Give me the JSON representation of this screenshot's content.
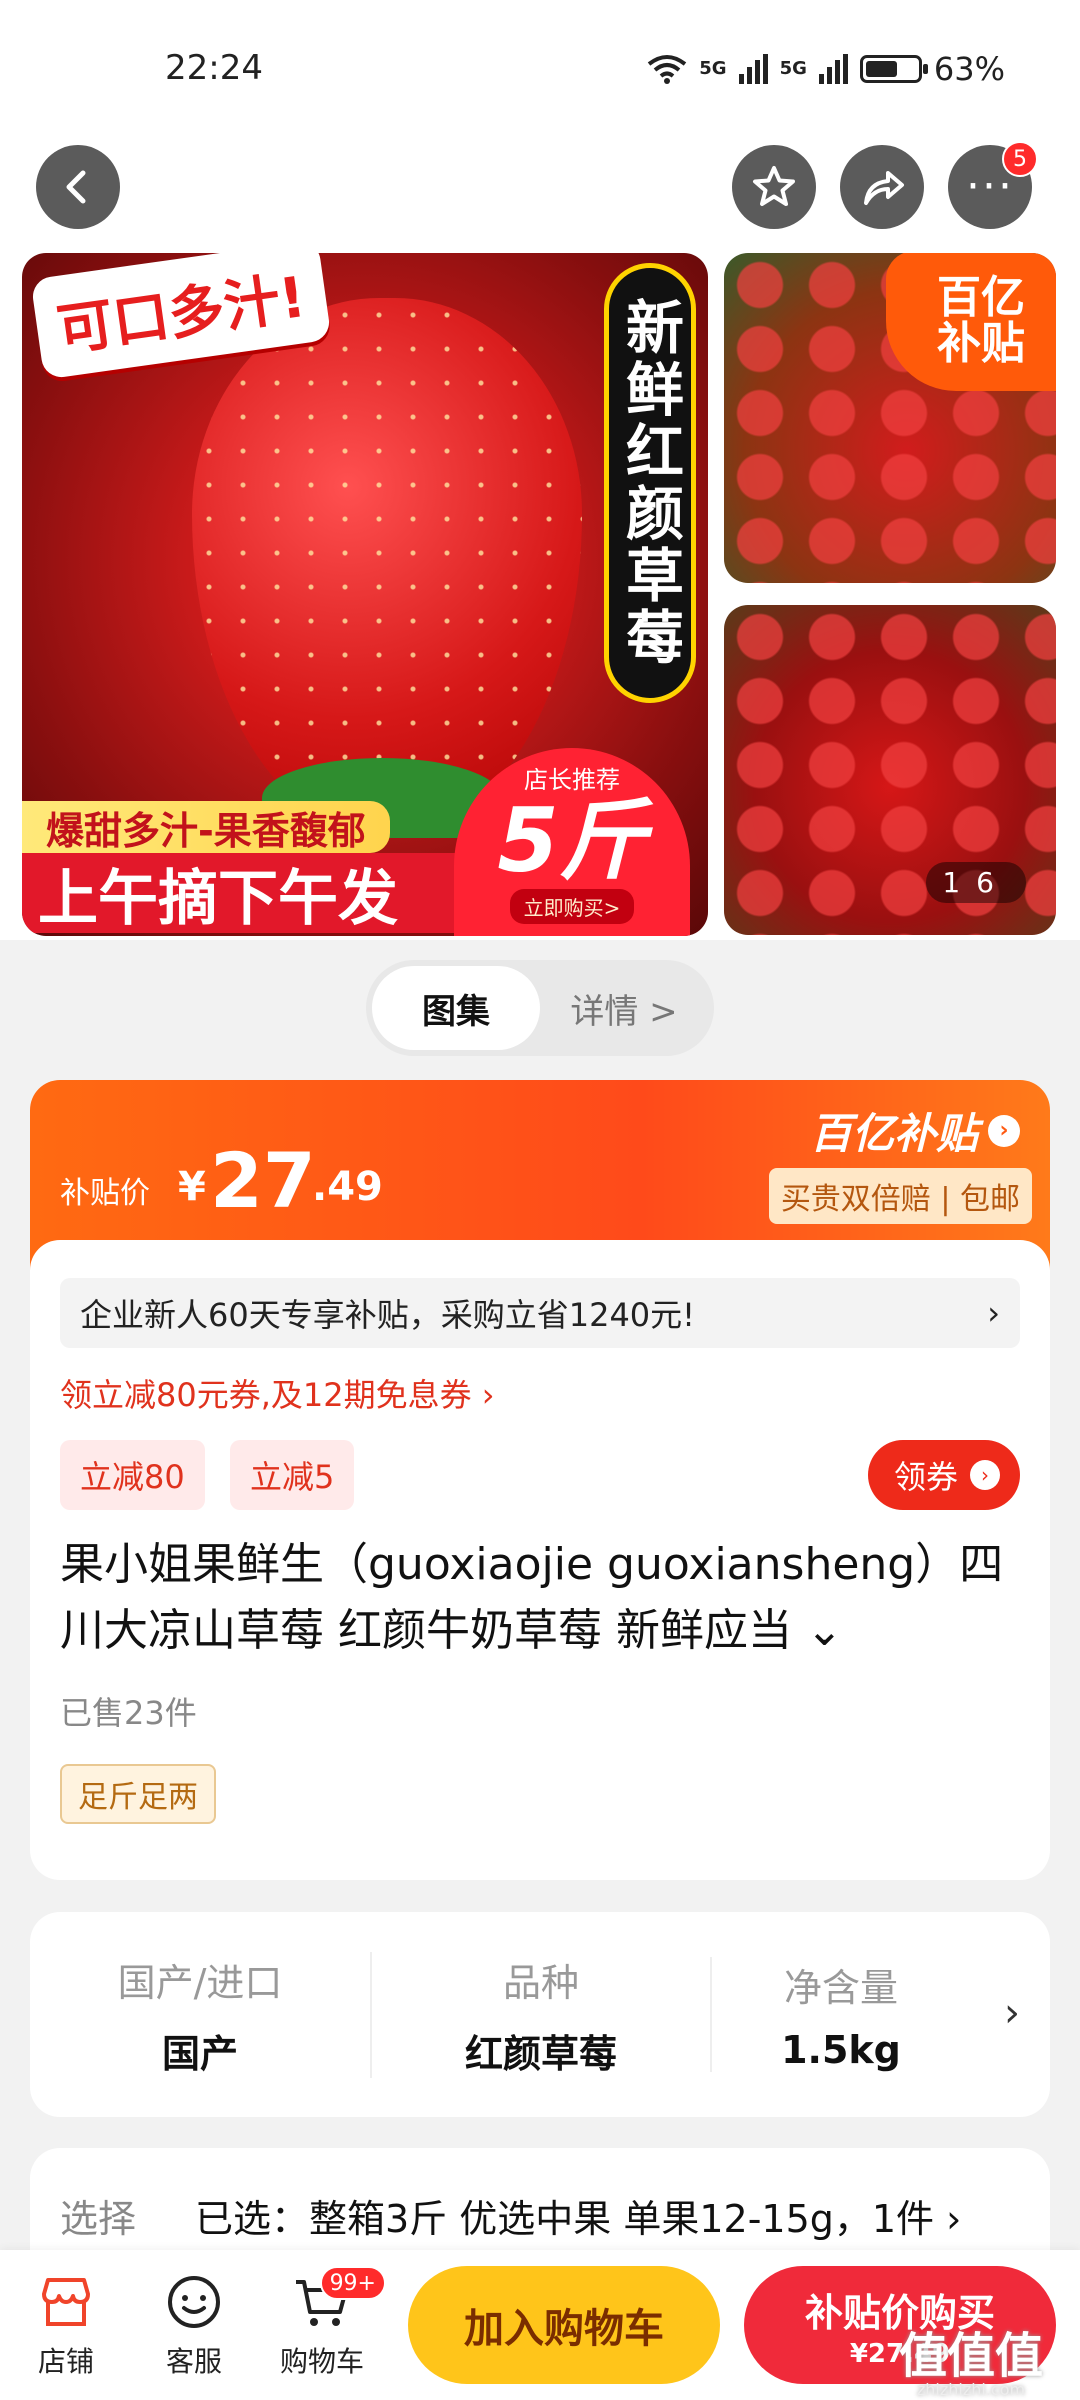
{
  "status_bar": {
    "time": "22:24",
    "signal_a": "5G",
    "signal_b": "5G",
    "battery": "63%",
    "battery_level": 0.63
  },
  "nav": {
    "back_icon": "chevron-left-icon",
    "favorite_icon": "star-icon",
    "share_icon": "share-icon",
    "more_icon": "more-icon",
    "more_badge": "5"
  },
  "gallery": {
    "main_tag": "可口多汁!",
    "main_vertical_title": "新鲜红颜草莓",
    "sweet_line": "爆甜多汁-果香馥郁",
    "morning_line": "上午摘下午发",
    "recommend_label": "店长推荐",
    "recommend_qty": "5斤",
    "recommend_cta": "立即购买>",
    "subsidy_badge_line1": "百亿",
    "subsidy_badge_line2": "补贴",
    "counter_current": "1",
    "counter_total": "6"
  },
  "view_tabs": {
    "gallery": "图集",
    "details": "详情 >"
  },
  "price": {
    "label": "补贴价",
    "currency": "¥",
    "integer": "27",
    "decimal": ".49",
    "subsidy_logo": "百亿补贴",
    "guarantee": "买贵双倍赔 | 包邮"
  },
  "promo": {
    "banner": "企业新人60天专享补贴，采购立省1240元!",
    "banner_arrow": "›",
    "coupon_link": "领立减80元券,及12期免息券 ›",
    "tags": [
      "立减80",
      "立减5"
    ],
    "coupon_button": "领券"
  },
  "product": {
    "title": "果小姐果鲜生（guoxiaojie guoxiansheng）四川大凉山草莓 红颜牛奶草莓 新鲜应当 ⌄",
    "sold": "已售23件",
    "weight_tag": "足斤足两"
  },
  "specs": [
    {
      "label": "国产/进口",
      "value": "国产"
    },
    {
      "label": "品种",
      "value": "红颜草莓"
    },
    {
      "label": "净含量",
      "value": "1.5kg"
    }
  ],
  "selection": {
    "label": "选择",
    "value": "已选：整箱3斤 优选中果 单果12-15g，1件 ›"
  },
  "bottom_bar": {
    "shop": "店铺",
    "service": "客服",
    "cart": "购物车",
    "cart_badge": "99+",
    "add_to_cart": "加入购物车",
    "buy_label": "补贴价购买",
    "buy_price": "¥27.49"
  },
  "watermark": {
    "text": "值值值",
    "domain": "zhizhizhi.com"
  }
}
